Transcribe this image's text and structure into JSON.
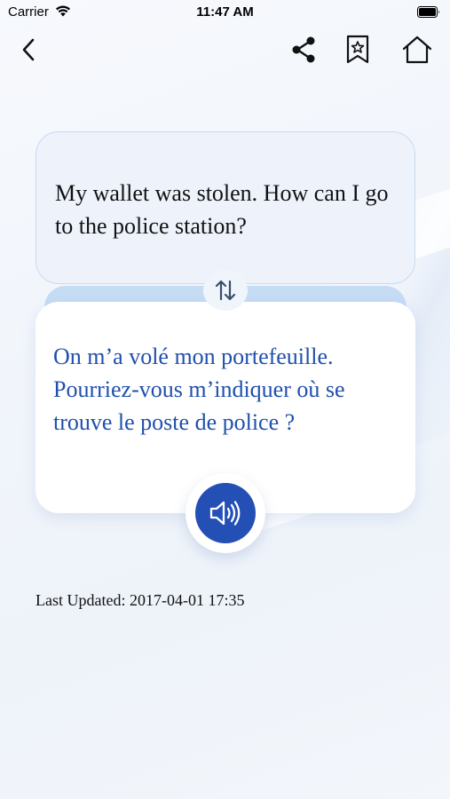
{
  "status_bar": {
    "carrier": "Carrier",
    "time": "11:47 AM"
  },
  "nav": {
    "icons": [
      "back-chevron-icon",
      "share-icon",
      "bookmark-star-icon",
      "home-icon"
    ]
  },
  "source": {
    "text": "My wallet was stolen. How can I go to the police station?"
  },
  "target": {
    "text": "On m’a volé mon portefeuille. Pourriez-vous m’indiquer où se trouve le poste de police ?"
  },
  "footer": {
    "last_updated": "Last Updated: 2017-04-01 17:35"
  },
  "colors": {
    "accent": "#2450b6",
    "target_text": "#1f4fae",
    "source_card": "#eef3fb",
    "ledge": "#c6dcf5"
  }
}
